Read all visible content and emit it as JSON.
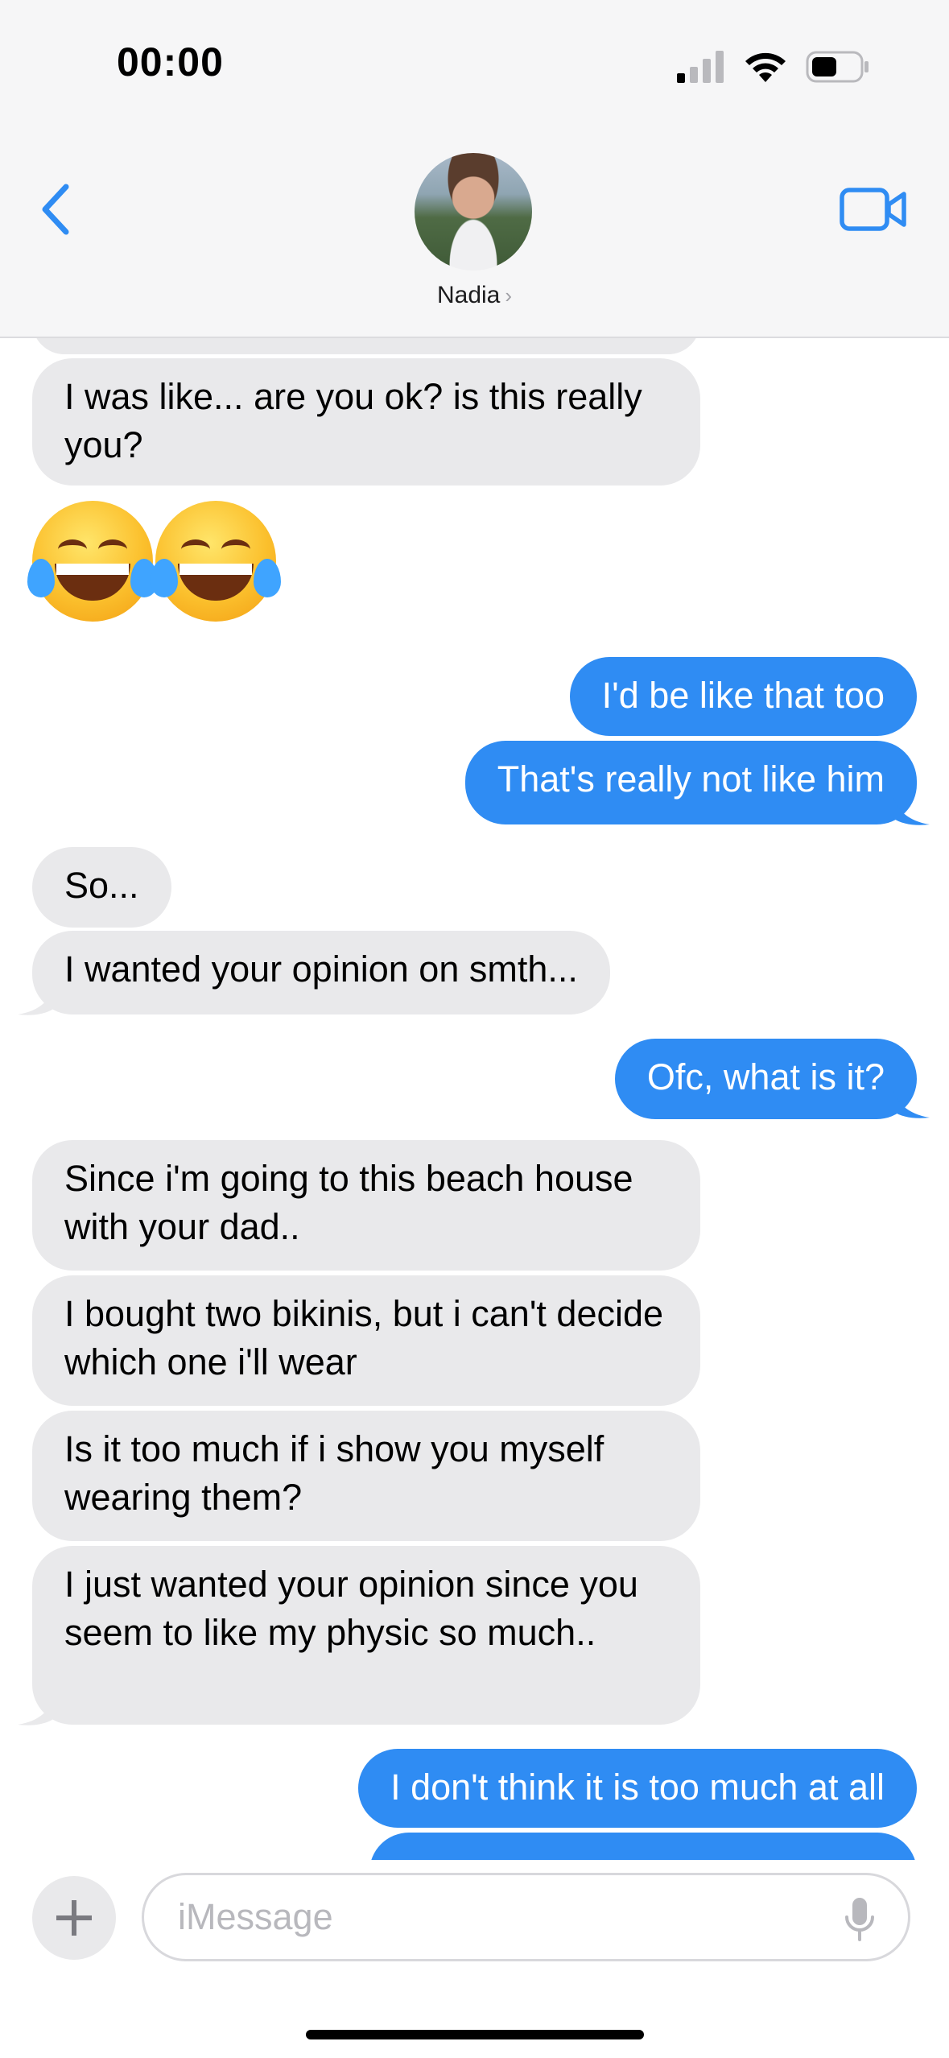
{
  "status_bar": {
    "time": "00:00",
    "icons": [
      "cellular-signal-icon",
      "wifi-icon",
      "battery-icon"
    ]
  },
  "header": {
    "contact_name": "Nadia",
    "contact_chevron": "›",
    "back_icon": "chevron-left-icon",
    "video_icon": "video-camera-icon",
    "accent_color": "#2f8cf3"
  },
  "messages": [
    {
      "from": "contact",
      "text": "I was like... are you ok? is this really you?"
    },
    {
      "from": "contact",
      "text": "😂😂",
      "kind": "emoji"
    },
    {
      "from": "me",
      "text": "I'd be like that too"
    },
    {
      "from": "me",
      "text": "That's really not like him"
    },
    {
      "from": "contact",
      "text": "So..."
    },
    {
      "from": "contact",
      "text": "I wanted your opinion on smth..."
    },
    {
      "from": "me",
      "text": "Ofc, what is it?"
    },
    {
      "from": "contact",
      "text": "Since i'm going to this beach house with your dad.."
    },
    {
      "from": "contact",
      "text": "I bought two bikinis, but i can't decide which one i'll wear"
    },
    {
      "from": "contact",
      "text": "Is it too much if i show you myself wearing them?"
    },
    {
      "from": "contact",
      "text": "I just wanted your opinion since you seem to like my physic so much.."
    },
    {
      "from": "me",
      "text": "I don't think it is too much at all"
    }
  ],
  "input": {
    "placeholder": "iMessage",
    "plus_icon": "plus-icon",
    "mic_icon": "microphone-icon"
  },
  "colors": {
    "incoming_bubble": "#e9e9eb",
    "outgoing_bubble": "#2f8cf3",
    "header_bg": "#f6f6f7"
  }
}
